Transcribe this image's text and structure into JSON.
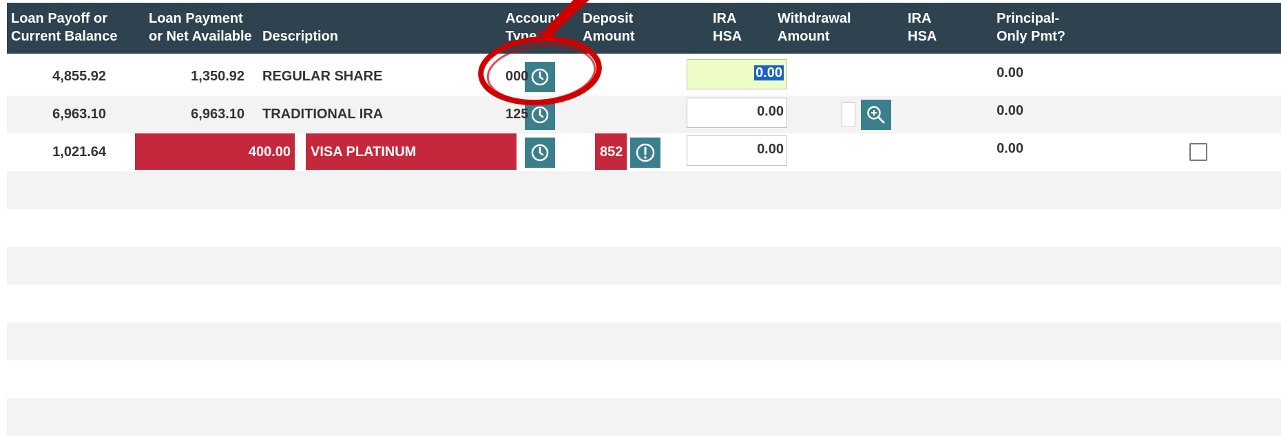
{
  "headers": {
    "balance": [
      "Loan Payoff or",
      "Current Balance"
    ],
    "payment": [
      "Loan Payment",
      "or Net Available"
    ],
    "description": "Description",
    "account_type": [
      "Account",
      "Type"
    ],
    "deposit": [
      "Deposit",
      "Amount"
    ],
    "ira_hsa_deposit": [
      "IRA",
      "HSA"
    ],
    "withdrawal": [
      "Withdrawal",
      "Amount"
    ],
    "ira_hsa_withdrawal": [
      "IRA",
      "HSA"
    ],
    "principal_only": [
      "Principal-",
      "Only Pmt?"
    ]
  },
  "rows": [
    {
      "balance": "4,855.92",
      "payment": "1,350.92",
      "description": "REGULAR SHARE",
      "account_type": "000",
      "deposit": "0.00",
      "withdrawal": "0.00"
    },
    {
      "balance": "6,963.10",
      "payment": "6,963.10",
      "description": "TRADITIONAL IRA",
      "account_type": "125",
      "deposit": "0.00",
      "withdrawal": "0.00"
    },
    {
      "balance": "1,021.64",
      "payment": "400.00",
      "description": "VISA PLATINUM",
      "account_type": "852",
      "deposit": "0.00",
      "withdrawal": "0.00"
    }
  ],
  "icons": {
    "history": "clock-icon",
    "ira_lookup": "zoom-in-icon",
    "alert": "exclamation-circle-icon"
  },
  "colors": {
    "header_bg": "#2e434f",
    "alert_red": "#c5283c",
    "icon_teal": "#3c7f8c",
    "active_input_bg": "#eefcc5",
    "selection_blue": "#1a62c9",
    "annotation_red": "#d00000"
  }
}
